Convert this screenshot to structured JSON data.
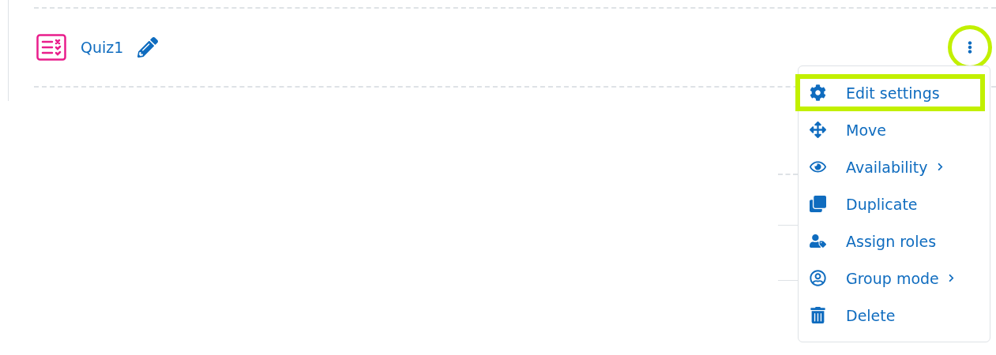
{
  "activity": {
    "name": "Quiz1"
  },
  "actions_button": {
    "highlighted": true
  },
  "menu": {
    "items": [
      {
        "label": "Edit settings",
        "has_submenu": false,
        "highlighted": true
      },
      {
        "label": "Move",
        "has_submenu": false,
        "highlighted": false
      },
      {
        "label": "Availability",
        "has_submenu": true,
        "highlighted": false
      },
      {
        "label": "Duplicate",
        "has_submenu": false,
        "highlighted": false
      },
      {
        "label": "Assign roles",
        "has_submenu": false,
        "highlighted": false
      },
      {
        "label": "Group mode",
        "has_submenu": true,
        "highlighted": false
      },
      {
        "label": "Delete",
        "has_submenu": false,
        "highlighted": false
      }
    ]
  }
}
